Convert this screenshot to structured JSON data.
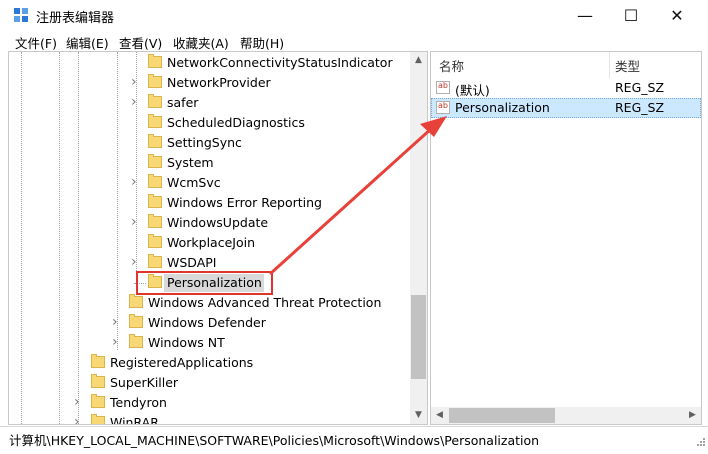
{
  "window": {
    "title": "注册表编辑器",
    "minimize": "—",
    "maximize": "☐",
    "close": "✕"
  },
  "menu": [
    "文件(F)",
    "编辑(E)",
    "查看(V)",
    "收藏夹(A)",
    "帮助(H)"
  ],
  "tree": [
    {
      "label": "NetworkConnectivityStatusIndicator",
      "expandable": false,
      "level": 2
    },
    {
      "label": "NetworkProvider",
      "expandable": true,
      "level": 2
    },
    {
      "label": "safer",
      "expandable": true,
      "level": 2
    },
    {
      "label": "ScheduledDiagnostics",
      "expandable": false,
      "level": 2
    },
    {
      "label": "SettingSync",
      "expandable": false,
      "level": 2
    },
    {
      "label": "System",
      "expandable": false,
      "level": 2
    },
    {
      "label": "WcmSvc",
      "expandable": true,
      "level": 2
    },
    {
      "label": "Windows Error Reporting",
      "expandable": false,
      "level": 2
    },
    {
      "label": "WindowsUpdate",
      "expandable": true,
      "level": 2
    },
    {
      "label": "WorkplaceJoin",
      "expandable": false,
      "level": 2
    },
    {
      "label": "WSDAPI",
      "expandable": true,
      "level": 2
    },
    {
      "label": "Personalization",
      "expandable": false,
      "level": 2,
      "selected": true
    },
    {
      "label": "Windows Advanced Threat Protection",
      "expandable": false,
      "level": 1
    },
    {
      "label": "Windows Defender",
      "expandable": true,
      "level": 1
    },
    {
      "label": "Windows NT",
      "expandable": true,
      "level": 1
    },
    {
      "label": "RegisteredApplications",
      "expandable": false,
      "level": 0
    },
    {
      "label": "SuperKiller",
      "expandable": false,
      "level": 0
    },
    {
      "label": "Tendyron",
      "expandable": true,
      "level": 0
    },
    {
      "label": "WinRAR",
      "expandable": true,
      "level": 0
    }
  ],
  "values_pane": {
    "columns": [
      "名称",
      "类型"
    ],
    "rows": [
      {
        "name": "(默认)",
        "type": "REG_SZ",
        "selected": false,
        "icon": "string-value-icon"
      },
      {
        "name": "Personalization",
        "type": "REG_SZ",
        "selected": true,
        "icon": "string-value-icon"
      }
    ]
  },
  "status": {
    "path": "计算机\\HKEY_LOCAL_MACHINE\\SOFTWARE\\Policies\\Microsoft\\Windows\\Personalization"
  },
  "colors": {
    "highlight_box": "#e0352b",
    "arrow": "#e8413a",
    "selection": "#cce8ff",
    "folder": "#f8d775"
  }
}
